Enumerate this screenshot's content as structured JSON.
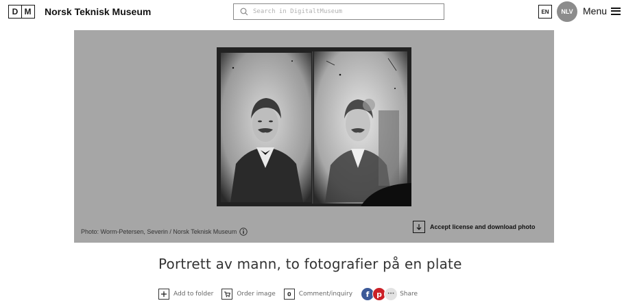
{
  "header": {
    "logo_letters": [
      "D",
      "M"
    ],
    "brand": "Norsk Teknisk Museum",
    "search_placeholder": "Search in DigitaltMuseum",
    "lang": "EN",
    "avatar": "NLV",
    "menu_label": "Menu"
  },
  "stage": {
    "credit": "Photo: Worm-Petersen, Severin / Norsk Teknisk Museum",
    "download_label": "Accept license and download photo"
  },
  "object": {
    "title": "Portrett av mann, to fotografier på en plate"
  },
  "actions": {
    "add_to_folder": "Add to folder",
    "order_image": "Order image",
    "comment_count": "0",
    "comment_inquiry": "Comment/inquiry",
    "share": "Share"
  },
  "colors": {
    "stage_bg": "#a6a6a6",
    "facebook": "#3b5998",
    "pinterest": "#cb2027"
  },
  "icons": [
    "logo",
    "search-icon",
    "hamburger-icon",
    "info-icon",
    "download-icon",
    "plus-icon",
    "cart-icon",
    "comment-icon",
    "facebook-icon",
    "pinterest-icon",
    "more-icon"
  ]
}
